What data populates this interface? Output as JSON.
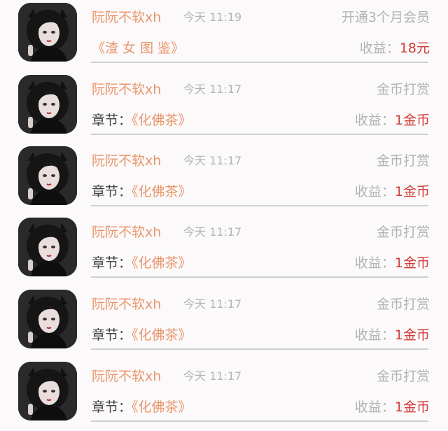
{
  "records": [
    {
      "name": "阮阮不软xh",
      "time": "今天 11:19",
      "action": "开通3个月会员",
      "detail_prefix": "",
      "detail_work": "《渣 女 图 鉴》",
      "earn_label": "收益：",
      "earn_value": "18元"
    },
    {
      "name": "阮阮不软xh",
      "time": "今天 11:17",
      "action": "金币打赏",
      "detail_prefix": "章节：",
      "detail_work": "《化佛茶》",
      "earn_label": "收益：",
      "earn_value": "1金币"
    },
    {
      "name": "阮阮不软xh",
      "time": "今天 11:17",
      "action": "金币打赏",
      "detail_prefix": "章节：",
      "detail_work": "《化佛茶》",
      "earn_label": "收益：",
      "earn_value": "1金币"
    },
    {
      "name": "阮阮不软xh",
      "time": "今天 11:17",
      "action": "金币打赏",
      "detail_prefix": "章节：",
      "detail_work": "《化佛茶》",
      "earn_label": "收益：",
      "earn_value": "1金币"
    },
    {
      "name": "阮阮不软xh",
      "time": "今天 11:17",
      "action": "金币打赏",
      "detail_prefix": "章节：",
      "detail_work": "《化佛茶》",
      "earn_label": "收益：",
      "earn_value": "1金币"
    },
    {
      "name": "阮阮不软xh",
      "time": "今天 11:17",
      "action": "金币打赏",
      "detail_prefix": "章节：",
      "detail_work": "《化佛茶》",
      "earn_label": "收益：",
      "earn_value": "1金币"
    }
  ],
  "colors": {
    "name": "#e9956c",
    "muted": "#b3b3b3",
    "earn_value": "#d23a3a",
    "text": "#444444"
  },
  "icons": {
    "avatar": "user-avatar-icon"
  }
}
